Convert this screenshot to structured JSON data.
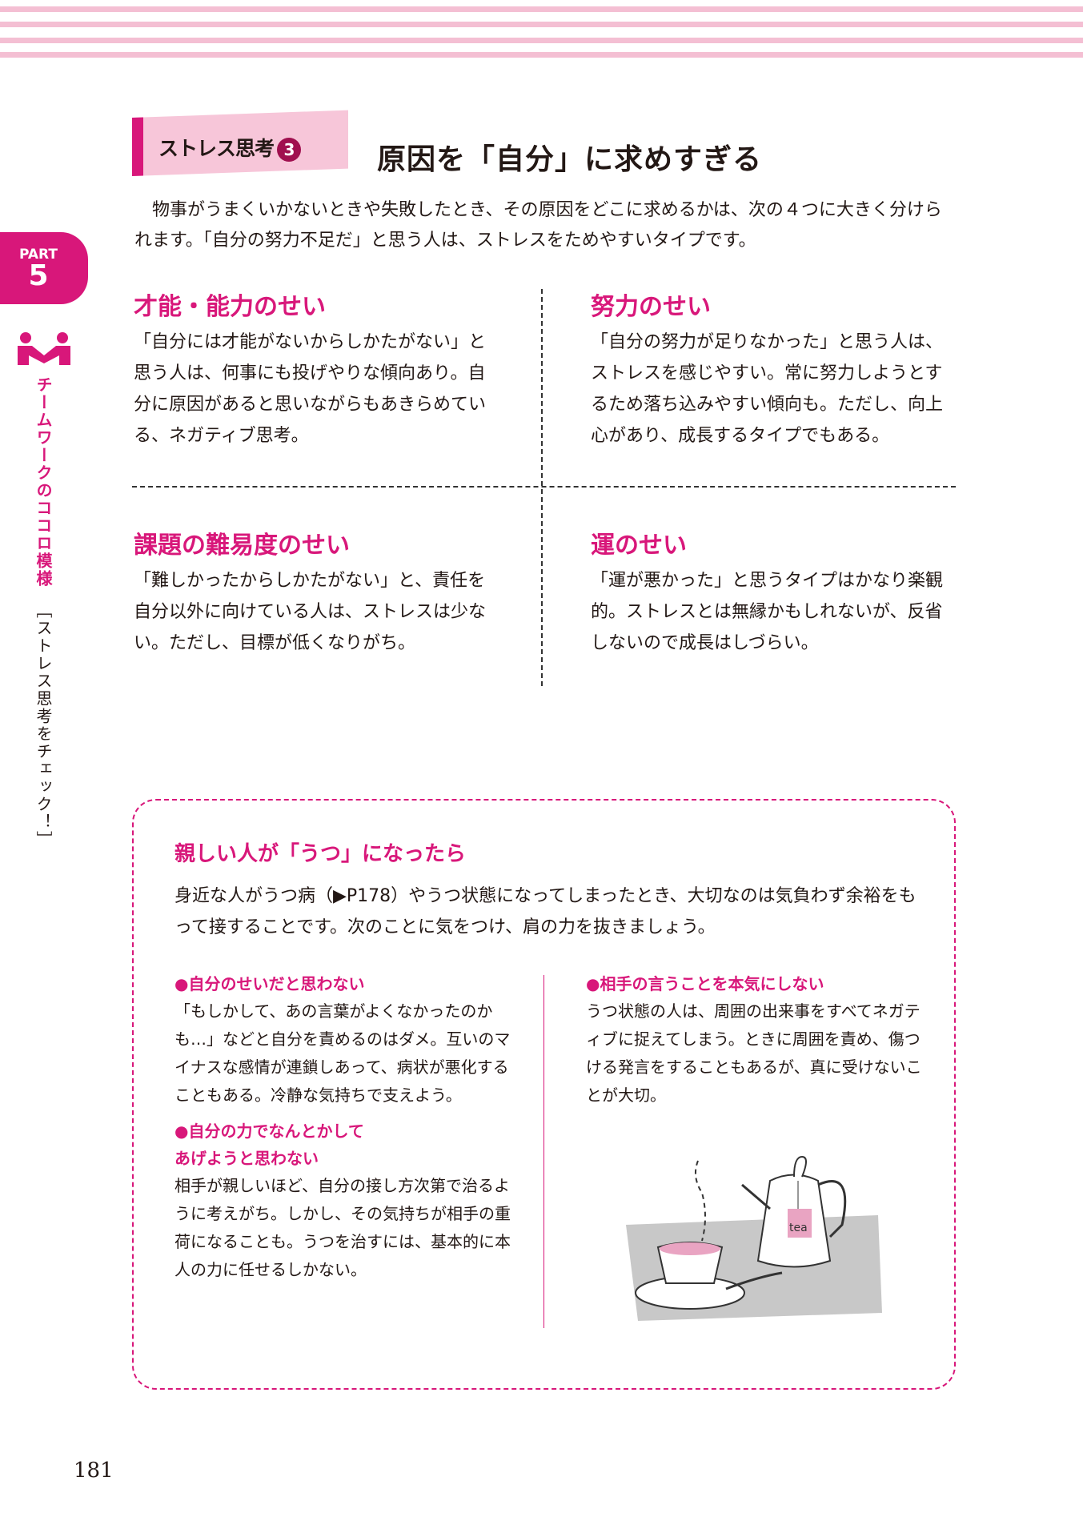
{
  "header": {
    "stripe_color": "#f4bfd3",
    "accent": "#d8177a"
  },
  "side": {
    "part_label": "PART",
    "part_number": "5",
    "chapter": "チームワークのココロ模様",
    "section": "［ストレス思考をチェック！］",
    "icon": "handshake-people-icon"
  },
  "section": {
    "tag": "ストレス思考",
    "tag_number": "3",
    "title": "原因を「自分」に求めすぎる",
    "intro": "物事がうまくいかないときや失敗したとき、その原因をどこに求めるかは、次の４つに大きく分けられます。「自分の努力不足だ」と思う人は、ストレスをためやすいタイプです。"
  },
  "quadrants": [
    {
      "heading": "才能・能力のせい",
      "text": "「自分には才能がないからしかたがない」と思う人は、何事にも投げやりな傾向あり。自分に原因があると思いながらもあきらめている、ネガティブ思考。"
    },
    {
      "heading": "努力のせい",
      "text": "「自分の努力が足りなかった」と思う人は、ストレスを感じやすい。常に努力しようとするため落ち込みやすい傾向も。ただし、向上心があり、成長するタイプでもある。"
    },
    {
      "heading": "課題の難易度のせい",
      "text": "「難しかったからしかたがない」と、責任を自分以外に向けている人は、ストレスは少ない。ただし、目標が低くなりがち。"
    },
    {
      "heading": "運のせい",
      "text": "「運が悪かった」と思うタイプはかなり楽観的。ストレスとは無縁かもしれないが、反省しないので成長はしづらい。"
    }
  ],
  "box": {
    "title": "親しい人が「うつ」になったら",
    "intro": "身近な人がうつ病（▶P178）やうつ状態になってしまったとき、大切なのは気負わず余裕をもって接することです。次のことに気をつけ、肩の力を抜きましょう。",
    "items": [
      {
        "heading": "●自分のせいだと思わない",
        "text": "「もしかして、あの言葉がよくなかったのかも…」などと自分を責めるのはダメ。互いのマイナスな感情が連鎖しあって、病状が悪化することもある。冷静な気持ちで支えよう。"
      },
      {
        "heading": "●自分の力でなんとかして　あげようと思わない",
        "text": "相手が親しいほど、自分の接し方次第で治るように考えがち。しかし、その気持ちが相手の重荷になることも。うつを治すには、基本的に本人の力に任せるしかない。"
      },
      {
        "heading": "●相手の言うことを本気にしない",
        "text": "うつ状態の人は、周囲の出来事をすべてネガティブに捉えてしまう。ときに周囲を責め、傷つける発言をすることもあるが、真に受けないことが大切。"
      }
    ],
    "illustration_label": "tea"
  },
  "page_number": "181"
}
